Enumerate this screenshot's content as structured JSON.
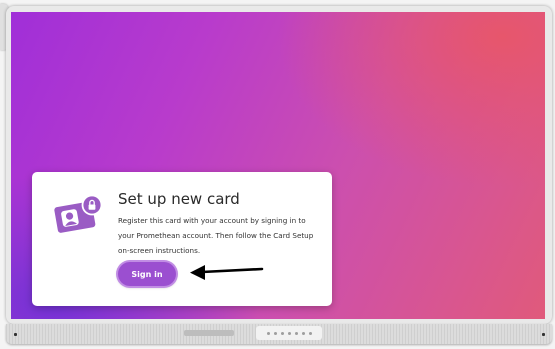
{
  "card": {
    "title": "Set up new card",
    "description": "Register this card with your account by signing in to your Promethean account. Then follow the Card Setup on-screen instructions.",
    "signin_label": "Sign in"
  },
  "colors": {
    "accent": "#9b4fd0",
    "accent_ring": "#c18de4",
    "icon_fill": "#9a5cc4",
    "background_purple": "#a02fd8",
    "background_pink": "#e05a7b"
  },
  "icons": [
    "id-card-icon",
    "lock-icon",
    "arrow-left-icon"
  ]
}
